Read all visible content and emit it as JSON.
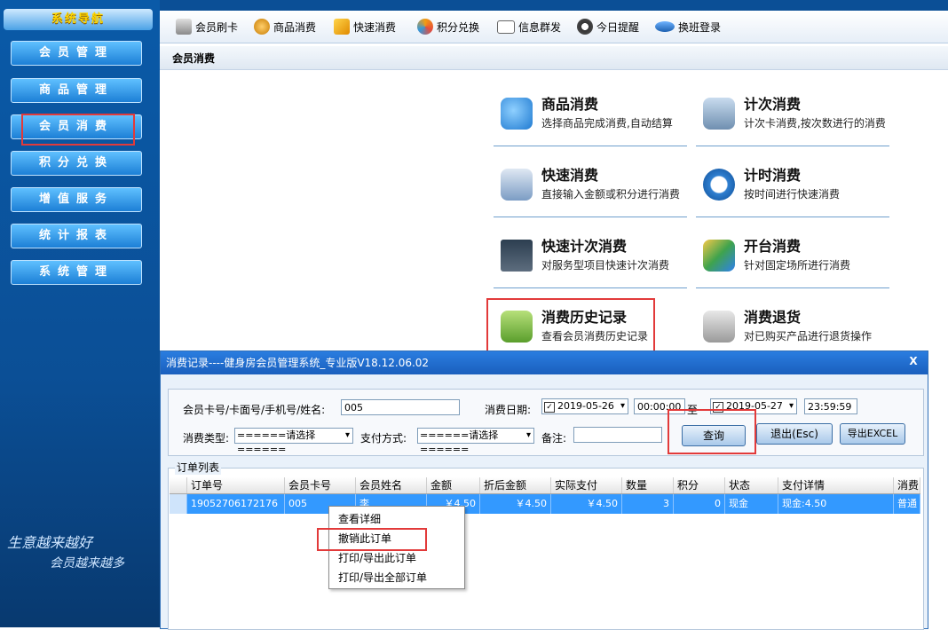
{
  "sidebar": {
    "title": "系统导航",
    "items": [
      {
        "label": "会员管理"
      },
      {
        "label": "商品管理"
      },
      {
        "label": "会员消费"
      },
      {
        "label": "积分兑换"
      },
      {
        "label": "增值服务"
      },
      {
        "label": "统计报表"
      },
      {
        "label": "系统管理"
      }
    ],
    "slogan_line1": "生意越来越好",
    "slogan_line2": "会员越来越多"
  },
  "toolbar": {
    "items": [
      {
        "label": "会员刷卡",
        "icon": "card-reader-icon"
      },
      {
        "label": "商品消费",
        "icon": "money-bag-icon"
      },
      {
        "label": "快速消费",
        "icon": "fast-consume-icon"
      },
      {
        "label": "积分兑换",
        "icon": "exchange-icon"
      },
      {
        "label": "信息群发",
        "icon": "envelope-icon"
      },
      {
        "label": "今日提醒",
        "icon": "clock-icon"
      },
      {
        "label": "换班登录",
        "icon": "shift-login-icon"
      }
    ]
  },
  "breadcrumb": "会员消费",
  "functions": [
    {
      "title": "商品消费",
      "desc": "选择商品完成消费,自动结算"
    },
    {
      "title": "计次消费",
      "desc": "计次卡消费,按次数进行的消费"
    },
    {
      "title": "快速消费",
      "desc": "直接输入金额或积分进行消费"
    },
    {
      "title": "计时消费",
      "desc": "按时间进行快速消费"
    },
    {
      "title": "快速计次消费",
      "desc": "对服务型项目快速计次消费"
    },
    {
      "title": "开台消费",
      "desc": "针对固定场所进行消费"
    },
    {
      "title": "消费历史记录",
      "desc": "查看会员消费历史记录"
    },
    {
      "title": "消费退货",
      "desc": "对已购买产品进行退货操作"
    }
  ],
  "dialog": {
    "title": "消费记录----健身房会员管理系统_专业版V18.12.06.02",
    "close": "X",
    "card_label": "会员卡号/卡面号/手机号/姓名:",
    "card_value": "005",
    "date_label": "消费日期:",
    "date_from": "2019-05-26",
    "time_from": "00:00:00",
    "to_label": "至",
    "date_to": "2019-05-27",
    "time_to": "23:59:59",
    "type_label": "消费类型:",
    "type_value": "======请选择======",
    "pay_label": "支付方式:",
    "pay_value": "======请选择======",
    "note_label": "备注:",
    "note_value": "",
    "query_btn": "查询",
    "exit_btn": "退出(Esc)",
    "export_btn": "导出EXCEL",
    "group_label": "订单列表",
    "columns": [
      "订单号",
      "会员卡号",
      "会员姓名",
      "金额",
      "折后金额",
      "实际支付",
      "数量",
      "积分",
      "状态",
      "支付详情",
      "消费"
    ],
    "rows": [
      {
        "order": "19052706172176",
        "card": "005",
        "name": "李",
        "amount": "￥4.50",
        "discount": "￥4.50",
        "paid": "￥4.50",
        "qty": "3",
        "points": "0",
        "status": "现金",
        "detail": "现金:4.50",
        "extra": "普通"
      }
    ]
  },
  "context_menu": [
    "查看详细",
    "撤销此订单",
    "打印/导出此订单",
    "打印/导出全部订单"
  ]
}
